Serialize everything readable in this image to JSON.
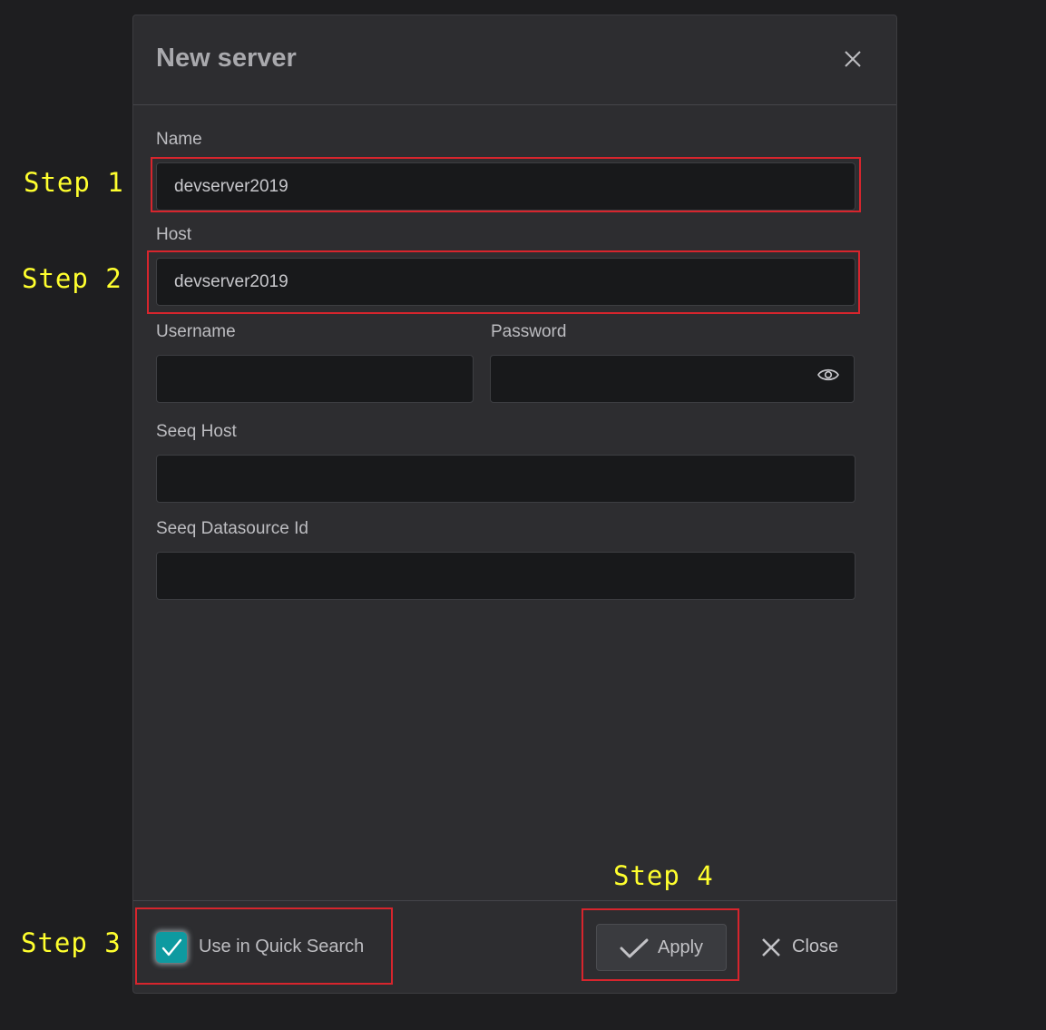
{
  "dialog": {
    "title": "New server",
    "close_icon": "close-icon"
  },
  "form": {
    "name": {
      "label": "Name",
      "value": "devserver2019"
    },
    "host": {
      "label": "Host",
      "value": "devserver2019"
    },
    "username": {
      "label": "Username",
      "value": ""
    },
    "password": {
      "label": "Password",
      "value": "",
      "toggle_icon": "eye-icon"
    },
    "seeq_host": {
      "label": "Seeq Host",
      "value": ""
    },
    "seeq_datasource_id": {
      "label": "Seeq Datasource Id",
      "value": ""
    }
  },
  "footer": {
    "quick_search": {
      "label": "Use in Quick Search",
      "checked": true,
      "icon": "checkmark-icon"
    },
    "apply": {
      "label": "Apply",
      "icon": "checkmark-icon"
    },
    "close": {
      "label": "Close",
      "icon": "close-icon"
    }
  },
  "annotations": {
    "step1": "Step 1",
    "step2": "Step 2",
    "step3": "Step 3",
    "step4": "Step 4"
  },
  "colors": {
    "checkbox_accent": "#0e9aa0",
    "annotation_text": "#ffff2e",
    "annotation_box": "#d7252d"
  }
}
